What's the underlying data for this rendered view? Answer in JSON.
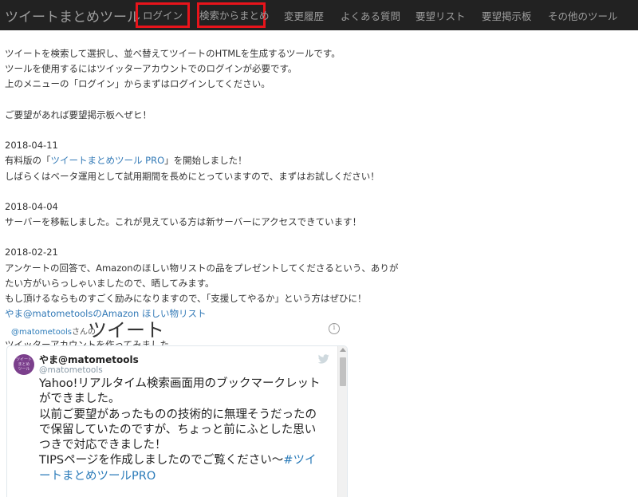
{
  "navbar": {
    "brand": "ツイートまとめツール",
    "items": [
      {
        "label": "ログイン"
      },
      {
        "label": "検索からまとめ"
      },
      {
        "label": "変更履歴"
      },
      {
        "label": "よくある質問"
      },
      {
        "label": "要望リスト"
      },
      {
        "label": "要望掲示板"
      },
      {
        "label": "その他のツール"
      }
    ],
    "highlight_color": "#e8141b"
  },
  "intro": {
    "line1": "ツイートを検索して選択し、並べ替えてツイートのHTMLを生成するツールです。",
    "line2": "ツールを使用するにはツイッターアカウントでのログインが必要です。",
    "line3": "上のメニューの「ログイン」からまずはログインしてください。",
    "request": "ご要望があれば要望掲示板へぜヒ！"
  },
  "news": [
    {
      "date": "2018-04-11",
      "line1_before": "有料版の「",
      "line1_link": "ツイートまとめツール PRO",
      "line1_after": "」を開始しました！",
      "line2": "しばらくはベータ運用として試用期間を長めにとっていますので、まずはお試しください！"
    },
    {
      "date": "2018-04-04",
      "line1": "サーバーを移転しました。これが見えている方は新サーバーにアクセスできています！"
    },
    {
      "date": "2018-02-21",
      "line1": "アンケートの回答で、Amazonのほしい物リストの品をプレゼントしてくださるという、ありが",
      "line2": "たい方がいらっしゃいましたので、晒してみます。",
      "line3": "もし頂けるならものすごく励みになりますので、「支援してやるか」という方はぜひに！",
      "link": "やま@matometoolsのAmazon ほしい物リスト"
    }
  ],
  "account_note": "ツイッターアカウントを作ってみました。",
  "embed": {
    "handle": "@matometools",
    "san": "さんの",
    "title": "ツイート",
    "info": "i",
    "avatar_text": [
      "ツイート",
      "まとめ",
      "ツール"
    ],
    "tweet": {
      "name": "やま@matometools",
      "handle": "@matometools",
      "lines": [
        "Yahoo!リアルタイム検索画面用のブックマークレット",
        "ができました。",
        "以前ご要望があったものの技術的に無理そうだったの",
        "で保留していたのですが、ちょっと前にふとした思い",
        "つきで対応できました！"
      ],
      "last_text": "TIPSページを作成しましたのでご覧ください〜",
      "hashtag_a": "#ツイ",
      "hashtag_b": "ートまとめツールPRO"
    }
  },
  "colors": {
    "navbar_bg": "#222222",
    "nav_text": "#9d9d9d",
    "link": "#337ab7",
    "tweet_link": "#2b7bb9",
    "avatar": "#7b3f8c"
  }
}
